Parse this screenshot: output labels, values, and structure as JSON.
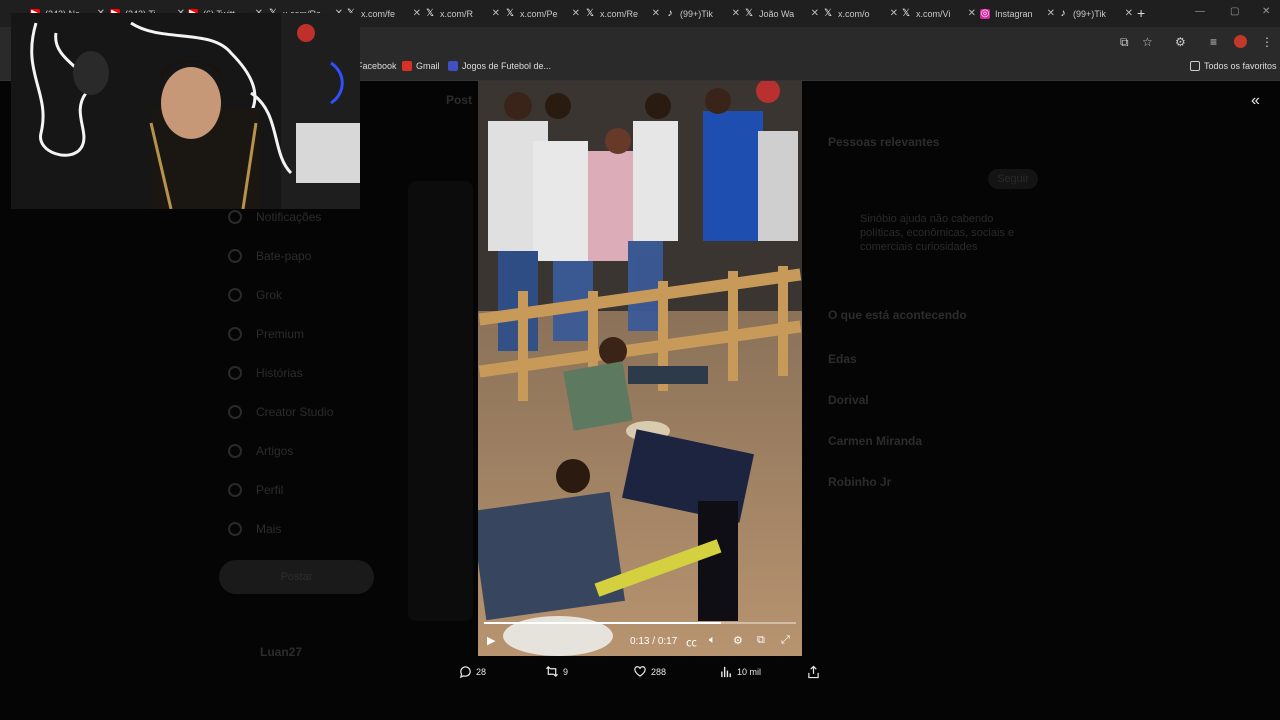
{
  "browser": {
    "tabs": [
      {
        "label": "(242) Ne",
        "icon": "youtube"
      },
      {
        "label": "(242) Ti",
        "icon": "youtube"
      },
      {
        "label": "(6) Twitt",
        "icon": "youtube"
      },
      {
        "label": "x.com/Ra",
        "icon": "x"
      },
      {
        "label": "x.com/fe",
        "icon": "x"
      },
      {
        "label": "x.com/R",
        "icon": "x"
      },
      {
        "label": "x.com/Pe",
        "icon": "x"
      },
      {
        "label": "x.com/Re",
        "icon": "x"
      },
      {
        "label": "(99+)Tik",
        "icon": "tiktok"
      },
      {
        "label": "João Wa",
        "icon": "x"
      },
      {
        "label": "x.com/o",
        "icon": "x"
      },
      {
        "label": "x.com/Vi",
        "icon": "x"
      },
      {
        "label": "Instagran",
        "icon": "instagram"
      },
      {
        "label": "(99+)Tik",
        "icon": "tiktok"
      }
    ],
    "new_tab": "+",
    "bookmarks": [
      {
        "label": "Facebook",
        "icon": "facebook"
      },
      {
        "label": "Gmail",
        "icon": "gmail"
      },
      {
        "label": "Jogos de Futebol de...",
        "icon": "games"
      }
    ],
    "all_bookmarks": "Todos os favoritos"
  },
  "background": {
    "nav_items": [
      "Notificações",
      "Bate-papo",
      "Grok",
      "Premium",
      "Histórias",
      "Creator Studio",
      "Artigos",
      "Perfil",
      "Mais"
    ],
    "post_button": "Postar",
    "header": "Post",
    "right": {
      "relevant_title": "Pessoas relevantes",
      "follow": "Seguir",
      "bio": "Sinóbio ajuda não cabendo políticas, econômicas, sociais e comerciais curiosidades",
      "trending_title": "O que está acontecendo",
      "trends": [
        "Edas",
        "Dorival",
        "Carmen Miranda",
        "Robinho Jr"
      ]
    },
    "user": "Luan27"
  },
  "video": {
    "time_current": "0:13",
    "time_total": "0:17",
    "progress": 0.76
  },
  "actions": {
    "replies": "28",
    "reposts": "9",
    "likes": "288",
    "views": "10 mil"
  }
}
